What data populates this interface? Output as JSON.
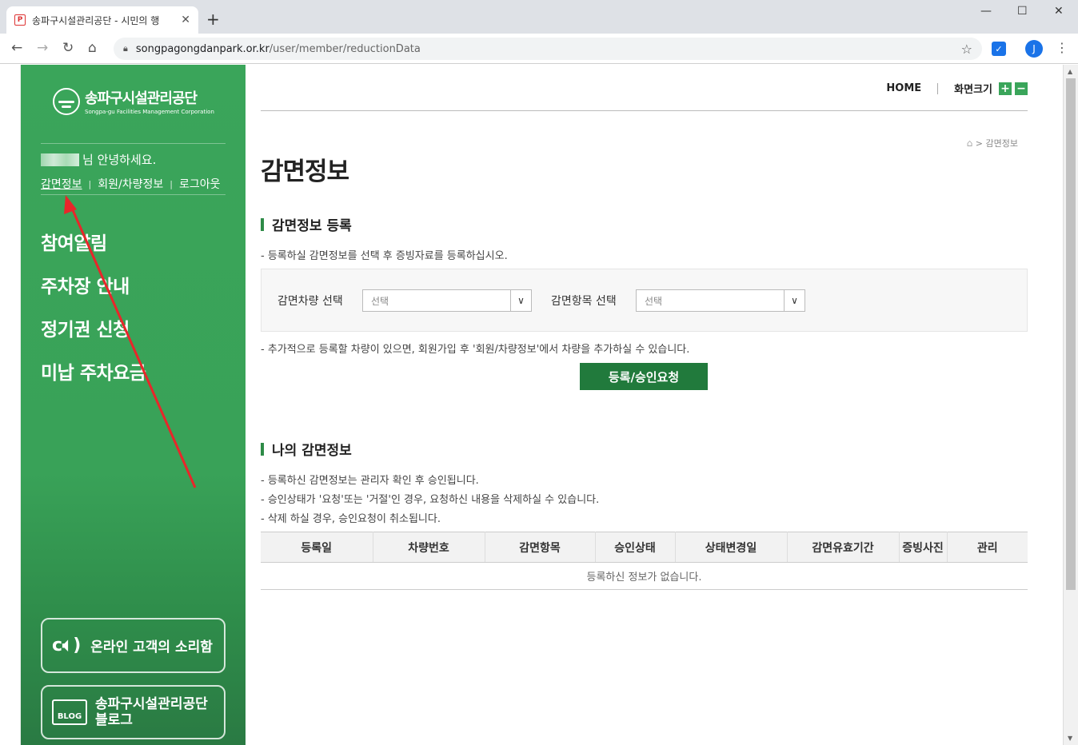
{
  "browser": {
    "tab_title": "송파구시설관리공단 - 시민의 행",
    "tab_favicon": "P",
    "new_tab": "+",
    "close_tab": "✕",
    "url_domain": "songpagongdanpark.or.kr",
    "url_path": "/user/member/reductionData",
    "profile_initial": "J",
    "win_min": "—",
    "win_max": "☐",
    "win_close": "✕"
  },
  "sidebar": {
    "logo_ko": "송파구시설관리공단",
    "logo_en": "Songpa-gu Facilities Management Corporation",
    "greeting": "님 안녕하세요.",
    "user_menu": [
      "감면정보",
      "회원/차량정보",
      "로그아웃"
    ],
    "menu": [
      "참여알림",
      "주차장 안내",
      "정기권 신청",
      "미납 주차요금"
    ],
    "voice_button": "온라인 고객의 소리함",
    "blog_button_line1": "송파구시설관리공단",
    "blog_button_line2": "블로그",
    "blog_icon_text": "BLOG"
  },
  "topnav": {
    "home": "HOME",
    "font_size": "화면크기",
    "zoom_in": "+",
    "zoom_out": "−"
  },
  "breadcrumb": {
    "separator": ">",
    "current": "감면정보"
  },
  "page_title": "감면정보",
  "register_section": {
    "heading": "감면정보 등록",
    "note": "- 등록하실 감면정보를 선택 후 증빙자료를 등록하십시오.",
    "vehicle_label": "감면차량 선택",
    "vehicle_value": "선택",
    "item_label": "감면항목 선택",
    "item_value": "선택",
    "additional_note": "- 추가적으로 등록할 차량이 있으면, 회원가입 후 '회원/차량정보'에서 차량을 추가하실 수 있습니다.",
    "submit_button": "등록/승인요청"
  },
  "my_section": {
    "heading": "나의 감면정보",
    "notes": [
      "- 등록하신 감면정보는 관리자 확인 후 승인됩니다.",
      "- 승인상태가 '요청'또는 '거절'인 경우, 요청하신 내용을 삭제하실 수 있습니다.",
      "- 삭제 하실 경우, 승인요청이 취소됩니다."
    ],
    "columns": [
      "등록일",
      "차량번호",
      "감면항목",
      "승인상태",
      "상태변경일",
      "감면유효기간",
      "증빙사진",
      "관리"
    ],
    "empty_message": "등록하신 정보가 없습니다."
  },
  "colors": {
    "brand_green": "#3aa55a",
    "button_green": "#217a3c",
    "annotation_arrow": "#e8262a"
  }
}
